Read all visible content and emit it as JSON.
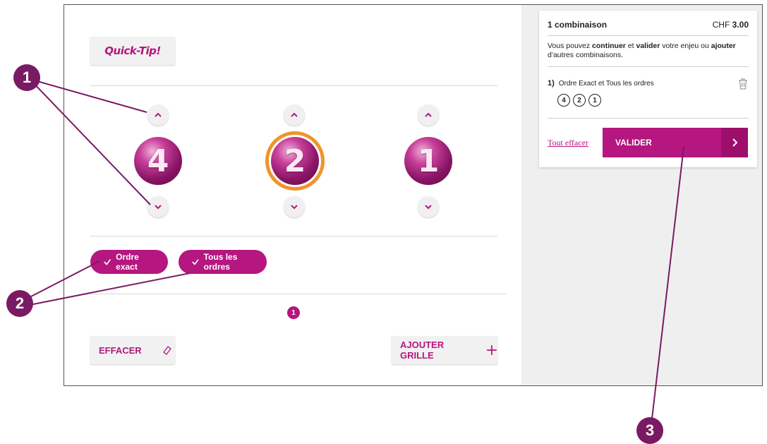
{
  "quicktip": {
    "label": "Quick-Tip!"
  },
  "balls": [
    {
      "number": "4",
      "selected": false
    },
    {
      "number": "2",
      "selected": true
    },
    {
      "number": "1",
      "selected": false
    }
  ],
  "options": {
    "exact": "Ordre exact",
    "all": "Tous les ordres"
  },
  "pagination": {
    "current": "1"
  },
  "actions": {
    "clear": "EFFACER",
    "add_grid": "AJOUTER GRILLE"
  },
  "ticket": {
    "title": "1 combinaison",
    "currency": "CHF",
    "price": "3.00",
    "info_1": "Vous pouvez ",
    "info_continue": "continuer",
    "info_2": " et ",
    "info_validate": "valider",
    "info_3": " votre enjeu ou ",
    "info_add": "ajouter",
    "info_4": " d'autres combinaisons.",
    "entry_index": "1)",
    "entry_label": "Ordre Exact et Tous les ordres",
    "entry_numbers": [
      "4",
      "2",
      "1"
    ],
    "clear_all": "Tout effacer",
    "validate": "VALIDER"
  },
  "annotations": [
    "1",
    "2",
    "3"
  ],
  "colors": {
    "accent": "#b5167f",
    "selected_ring": "#f0942b",
    "annotation": "#7a1a63"
  }
}
